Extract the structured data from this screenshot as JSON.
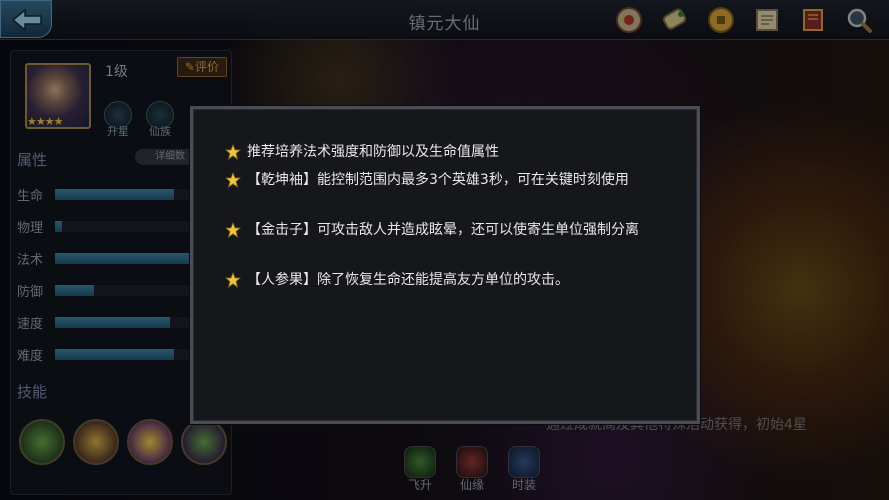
{
  "header": {
    "title": "镇元大仙",
    "icons": [
      "scroll-icon",
      "gourd-icon",
      "coin-icon",
      "map-icon",
      "book-icon",
      "magnifier-icon"
    ]
  },
  "hero": {
    "level": "1级",
    "rate_label": "评价",
    "stars": "★★★★",
    "star_count": 4,
    "upgrade_label": "升星",
    "clan_label": "仙族"
  },
  "attributes": {
    "title": "属性",
    "detail_label": "详细数",
    "stats": [
      {
        "label": "生命",
        "value": 0.85
      },
      {
        "label": "物理",
        "value": 0.05
      },
      {
        "label": "法术",
        "value": 1.0
      },
      {
        "label": "防御",
        "value": 0.28
      },
      {
        "label": "速度",
        "value": 0.82
      },
      {
        "label": "难度",
        "value": 0.85
      }
    ]
  },
  "skills": {
    "title": "技能"
  },
  "bottom_tabs": [
    "飞升",
    "仙缘",
    "时装"
  ],
  "source_text": "通过成就商及其他特殊活动获得，初始4星",
  "modal": {
    "tips": [
      "推荐培养法术强度和防御以及生命值属性",
      "【乾坤袖】能控制范围内最多3个英雄3秒，可在关键时刻使用",
      "【金击子】可攻击敌人并造成眩晕，还可以使寄生单位强制分离",
      "【人参果】除了恢复生命还能提高友方单位的攻击。"
    ]
  },
  "colors": {
    "star": "#f3c53a",
    "bar": "#3f86a8",
    "accent_gold": "#e0a24a"
  }
}
